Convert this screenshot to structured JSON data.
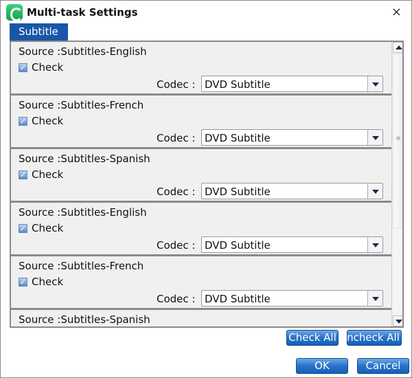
{
  "window": {
    "title": "Multi-task Settings",
    "close": "×"
  },
  "tab": {
    "label": "Subtitle"
  },
  "items": [
    {
      "source": "Source :Subtitles-English",
      "check": "Check",
      "checked": true,
      "codec_label": "Codec :",
      "codec": "DVD Subtitle"
    },
    {
      "source": "Source :Subtitles-French",
      "check": "Check",
      "checked": true,
      "codec_label": "Codec :",
      "codec": "DVD Subtitle"
    },
    {
      "source": "Source :Subtitles-Spanish",
      "check": "Check",
      "checked": true,
      "codec_label": "Codec :",
      "codec": "DVD Subtitle"
    },
    {
      "source": "Source :Subtitles-English",
      "check": "Check",
      "checked": true,
      "codec_label": "Codec :",
      "codec": "DVD Subtitle"
    },
    {
      "source": "Source :Subtitles-French",
      "check": "Check",
      "checked": true,
      "codec_label": "Codec :",
      "codec": "DVD Subtitle"
    },
    {
      "source": "Source :Subtitles-Spanish"
    }
  ],
  "buttons": {
    "check_all": "Check All",
    "uncheck_all": "Uncheck All",
    "ok": "OK",
    "cancel": "Cancel"
  },
  "colors": {
    "accent": "#1a56a8"
  }
}
